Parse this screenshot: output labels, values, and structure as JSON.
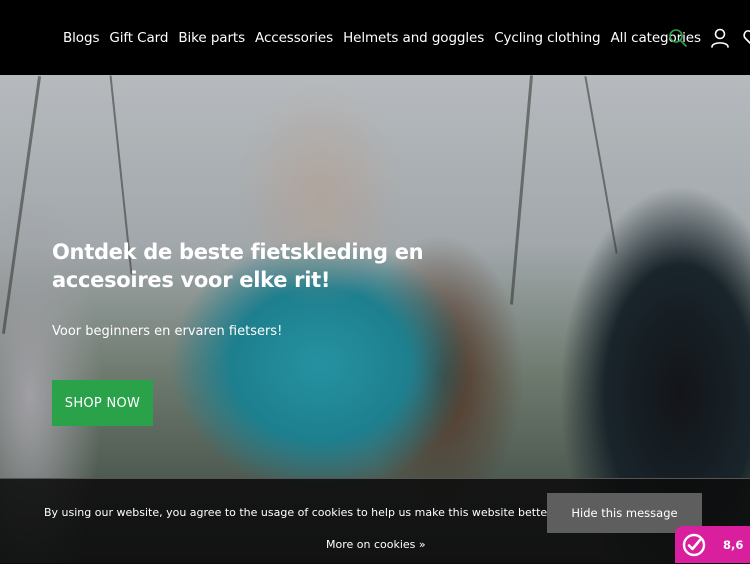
{
  "nav": {
    "items": [
      {
        "label": "Blogs"
      },
      {
        "label": "Gift Card"
      },
      {
        "label": "Bike parts"
      },
      {
        "label": "Accessories"
      },
      {
        "label": "Helmets and goggles"
      },
      {
        "label": "Cycling clothing"
      },
      {
        "label": "All categories"
      }
    ]
  },
  "header": {
    "icons": [
      "search-icon",
      "user-icon",
      "heart-icon"
    ],
    "search_icon_color": "#2aa24a"
  },
  "hero": {
    "title": "Ontdek de beste fietskleding en accesoires voor elke rit!",
    "subtitle": "Voor beginners en ervaren fietsers!",
    "button_label": "SHOP NOW",
    "button_color": "#2aa24a"
  },
  "cookie": {
    "message": "By using our website, you agree to the usage of cookies to help us make this website better.",
    "hide_label": "Hide this message",
    "more_label": "More on cookies »"
  },
  "rating": {
    "score": "8,6",
    "color": "#d91f9e"
  }
}
